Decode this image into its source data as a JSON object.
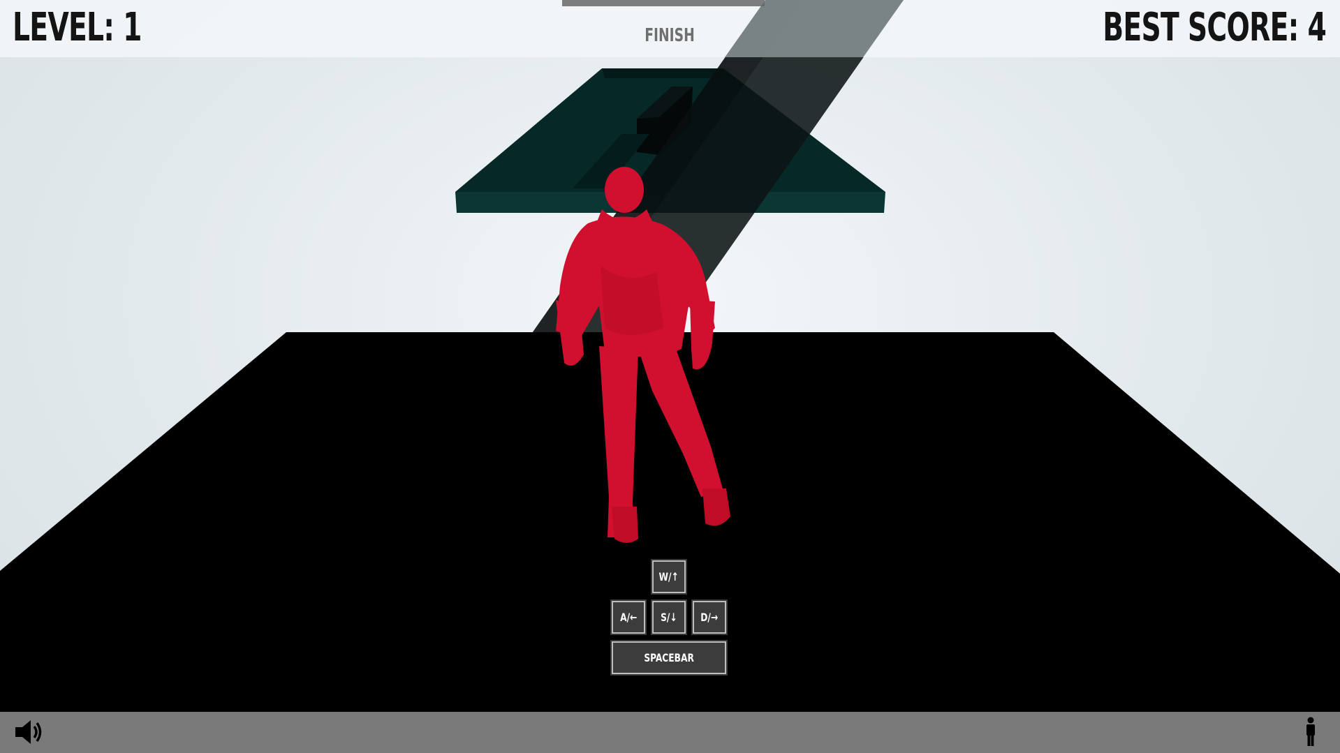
{
  "hud": {
    "level_label": "LEVEL: 1",
    "best_score_label": "BEST SCORE: 4",
    "finish_label": "FINISH"
  },
  "controls": {
    "up": "W/↑",
    "left": "A/←",
    "down": "S/↓",
    "right": "D/→",
    "jump": "SPACEBAR"
  },
  "icons": {
    "sound": "speaker-icon",
    "character": "person-icon"
  },
  "colors": {
    "player": "#d0102e",
    "platform": "#062928",
    "ground": "#000000",
    "sky": "#e4ebee",
    "bottom_bar": "#7a7a7a",
    "key_background": "#3c3c3c"
  }
}
